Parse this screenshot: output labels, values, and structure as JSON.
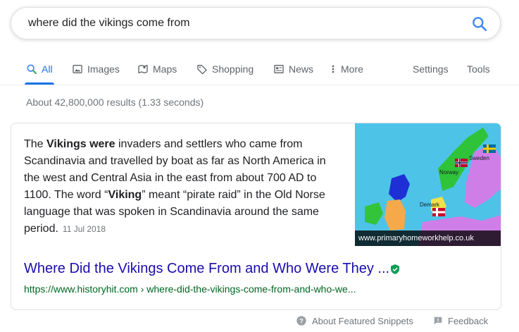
{
  "search": {
    "query": "where did the vikings come from"
  },
  "tabs": [
    {
      "label": "All",
      "icon": "search-icon"
    },
    {
      "label": "Images",
      "icon": "image-icon"
    },
    {
      "label": "Maps",
      "icon": "map-icon"
    },
    {
      "label": "Shopping",
      "icon": "tag-icon"
    },
    {
      "label": "News",
      "icon": "newspaper-icon"
    },
    {
      "label": "More",
      "icon": "more-vert-icon"
    }
  ],
  "tools": {
    "settings": "Settings",
    "tools": "Tools"
  },
  "stats": "About 42,800,000 results (1.33 seconds)",
  "snippet": {
    "t1": "The ",
    "b1": "Vikings were",
    "t2": " invaders and settlers who came from Scandinavia and travelled by boat as far as North America in the west and Central Asia in the east from about 700 AD to 1100. The word “",
    "b2": "Viking",
    "t3": "” meant “pirate raid” in the Old Norse language that was spoken in Scandinavia around the same period.",
    "date": "11 Jul 2018",
    "image_caption": "www.primaryhomeworkhelp.co.uk",
    "map_labels": {
      "sweden": "Sweden",
      "norway": "Norway",
      "denmark": "Demark"
    }
  },
  "result": {
    "title": "Where Did the Vikings Come From and Who Were They ...",
    "url": "https://www.historyhit.com › where-did-the-vikings-come-from-and-who-we..."
  },
  "footer": {
    "about": "About Featured Snippets",
    "feedback": "Feedback"
  },
  "colors": {
    "accent": "#1a73e8",
    "link": "#1a0dab",
    "url": "#006621"
  }
}
